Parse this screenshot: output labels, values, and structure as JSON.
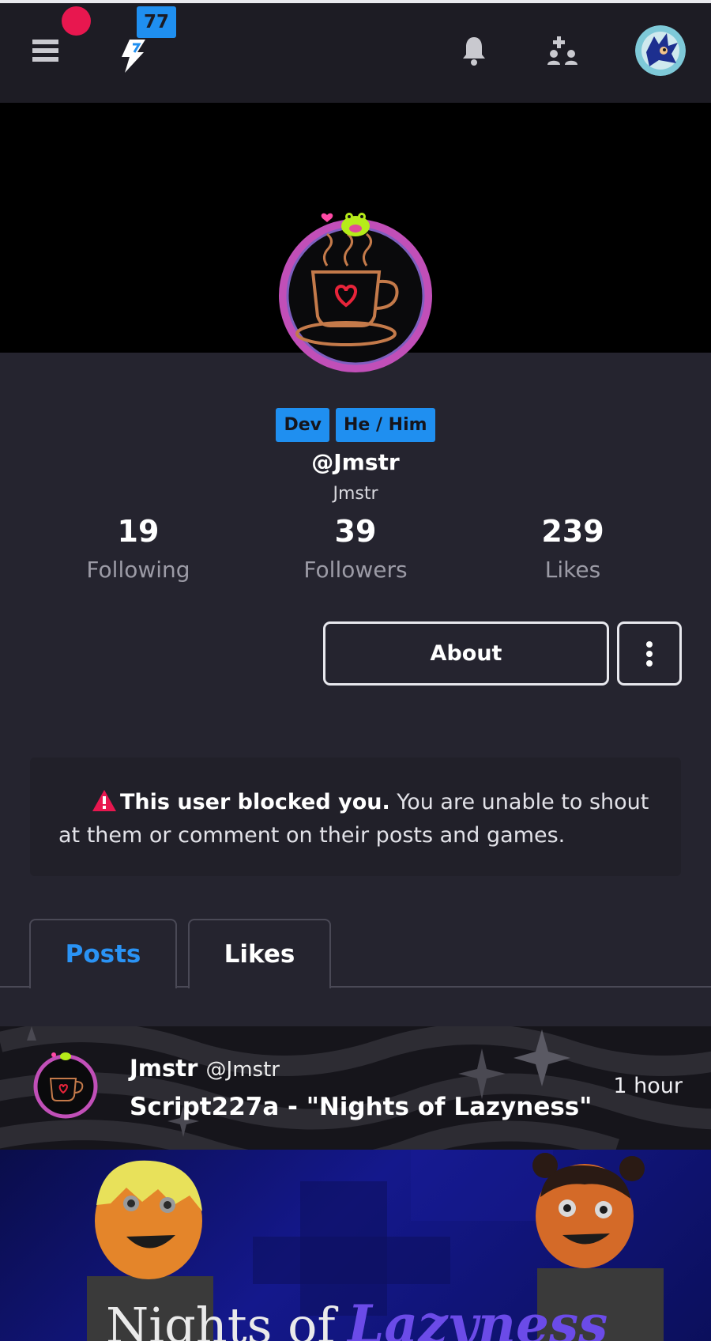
{
  "topbar": {
    "notification_count": "77"
  },
  "profile": {
    "tags": [
      "Dev",
      "He / Him"
    ],
    "handle": "@Jmstr",
    "display_name": "Jmstr",
    "stats": [
      {
        "value": "19",
        "label": "Following"
      },
      {
        "value": "39",
        "label": "Followers"
      },
      {
        "value": "239",
        "label": "Likes"
      }
    ],
    "about_label": "About"
  },
  "notice": {
    "bold": "This user blocked you.",
    "text": " You are unable to shout at them or comment on their posts and games."
  },
  "tabs": [
    {
      "label": "Posts",
      "active": true
    },
    {
      "label": "Likes",
      "active": false
    }
  ],
  "post": {
    "author": "Jmstr",
    "author_handle": "@Jmstr",
    "title": "Script227a - \"Nights of Lazyness\"",
    "time": "1 hour",
    "image_text_left": "Nights of",
    "image_text_right": "Lazyness"
  },
  "colors": {
    "accent": "#1f8ff0",
    "alert": "#e8174f",
    "background": "#25242f"
  }
}
